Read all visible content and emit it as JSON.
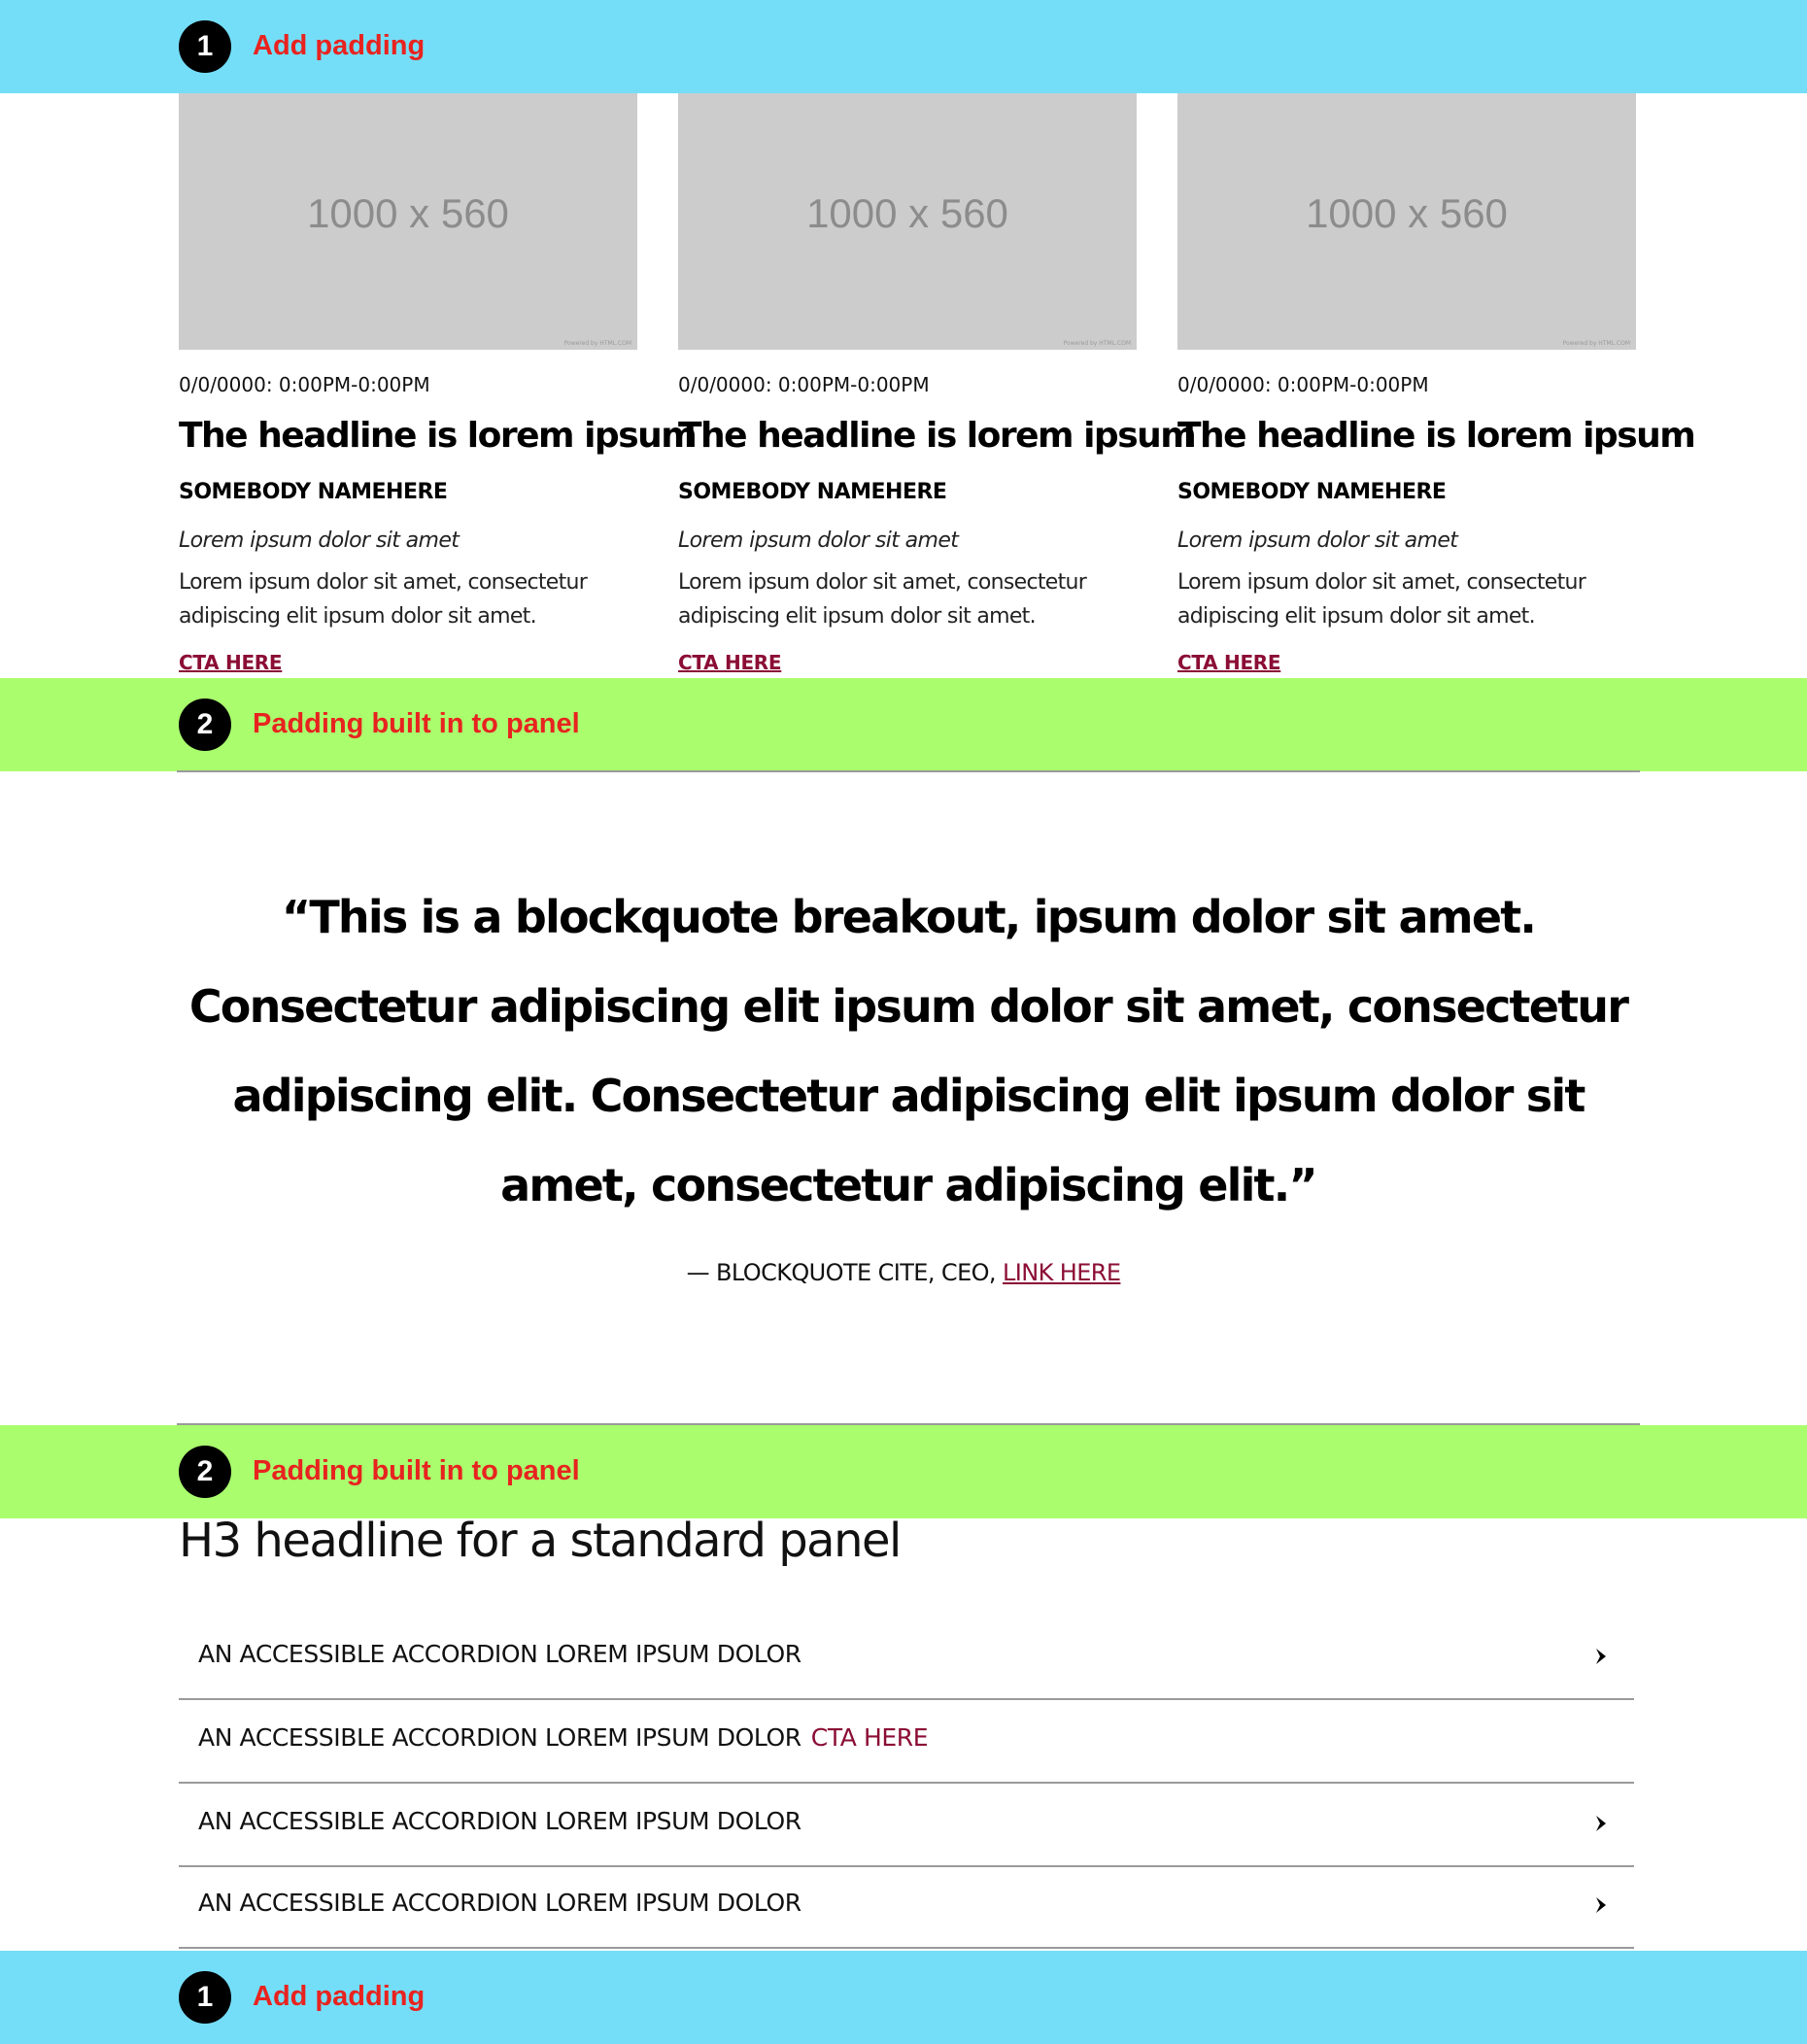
{
  "annotations": {
    "top": {
      "number": "1",
      "label": "Add padding",
      "color": "#74DEF8"
    },
    "mid1": {
      "number": "2",
      "label": "Padding built in to panel",
      "color": "#AAFE6E"
    },
    "mid2": {
      "number": "2",
      "label": "Padding built in to panel",
      "color": "#AAFE6E"
    },
    "bottom": {
      "number": "1",
      "label": "Add padding",
      "color": "#74DEF8"
    },
    "label_color": "#E8231F"
  },
  "cards": [
    {
      "image_placeholder": "1000 x 560",
      "image_credit": "Powered by HTML.COM",
      "date": "0/0/0000: 0:00PM-0:00PM",
      "headline": "The headline is lorem ipsum",
      "author": "SOMEBODY NAMEHERE",
      "subhead": "Lorem ipsum dolor sit amet",
      "body": "Lorem ipsum dolor sit amet, consectetur adipiscing elit ipsum dolor sit amet.",
      "cta": "CTA HERE"
    },
    {
      "image_placeholder": "1000 x 560",
      "image_credit": "Powered by HTML.COM",
      "date": "0/0/0000: 0:00PM-0:00PM",
      "headline": "The headline is lorem ipsum",
      "author": "SOMEBODY NAMEHERE",
      "subhead": "Lorem ipsum dolor sit amet",
      "body": "Lorem ipsum dolor sit amet, consectetur adipiscing elit ipsum dolor sit amet.",
      "cta": "CTA HERE"
    },
    {
      "image_placeholder": "1000 x 560",
      "image_credit": "Powered by HTML.COM",
      "date": "0/0/0000: 0:00PM-0:00PM",
      "headline": "The headline is lorem ipsum",
      "author": "SOMEBODY NAMEHERE",
      "subhead": "Lorem ipsum dolor sit amet",
      "body": "Lorem ipsum dolor sit amet, consectetur adipiscing elit ipsum dolor sit amet.",
      "cta": "CTA HERE"
    }
  ],
  "blockquote": {
    "text": "“This is a blockquote breakout, ipsum dolor sit amet. Consectetur adipiscing elit ipsum dolor sit amet, consectetur adipiscing elit. Consectetur adipiscing elit ipsum dolor sit amet, consectetur adipiscing elit.”",
    "cite_prefix": "— BLOCKQUOTE CITE, CEO, ",
    "cite_link": "LINK HERE"
  },
  "panel": {
    "h3": "H3 headline for a standard panel",
    "accordion": [
      {
        "label": "AN ACCESSIBLE ACCORDION LOREM IPSUM DOLOR",
        "icon": "chevron-right-icon"
      },
      {
        "label": "AN ACCESSIBLE ACCORDION LOREM IPSUM DOLOR",
        "cta": "CTA HERE"
      },
      {
        "label": "AN ACCESSIBLE ACCORDION LOREM IPSUM DOLOR",
        "icon": "chevron-right-icon"
      },
      {
        "label": "AN ACCESSIBLE ACCORDION LOREM IPSUM DOLOR",
        "icon": "chevron-right-icon"
      }
    ]
  },
  "colors": {
    "accent": "#8B0D35",
    "placeholder_bg": "#CCCCCC",
    "rule": "#9A9A9A"
  }
}
